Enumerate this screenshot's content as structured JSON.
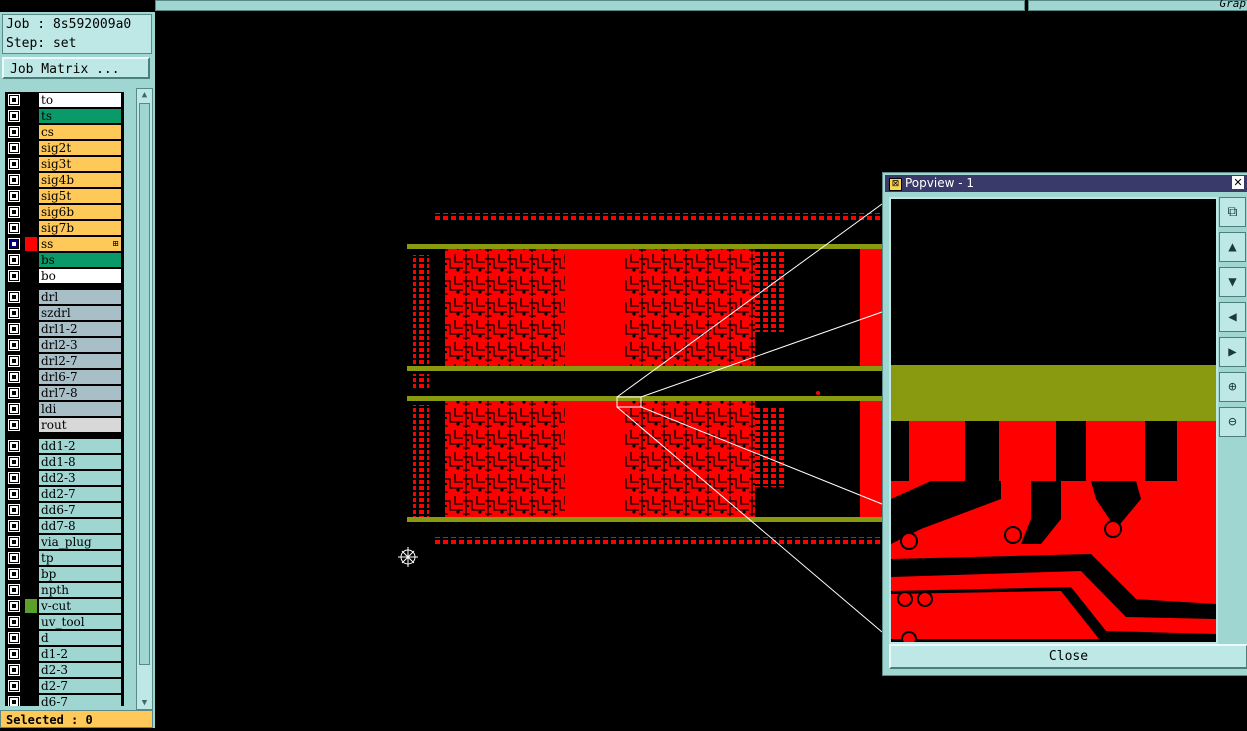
{
  "header": {
    "graph_label": "Grap"
  },
  "job": {
    "job_label": "Job : 8s592009a0",
    "step_label": "Step: set"
  },
  "job_matrix_button": "Job Matrix ...",
  "layer_groups": [
    [
      {
        "name": "to",
        "color": "#ffffff",
        "sel": false
      },
      {
        "name": "ts",
        "color": "#0a9a6a",
        "sel": false
      },
      {
        "name": "cs",
        "color": "#ffc95a",
        "sel": false
      },
      {
        "name": "sig2t",
        "color": "#ffc95a",
        "sel": false
      },
      {
        "name": "sig3t",
        "color": "#ffc95a",
        "sel": false
      },
      {
        "name": "sig4b",
        "color": "#ffc95a",
        "sel": false
      },
      {
        "name": "sig5t",
        "color": "#ffc95a",
        "sel": false
      },
      {
        "name": "sig6b",
        "color": "#ffc95a",
        "sel": false
      },
      {
        "name": "sig7b",
        "color": "#ffc95a",
        "sel": false
      },
      {
        "name": "ss",
        "color": "#ffc95a",
        "sel": true,
        "swatch": "#ff0000",
        "indicator": "⊞"
      },
      {
        "name": "bs",
        "color": "#0a9a6a",
        "sel": false
      },
      {
        "name": "bo",
        "color": "#ffffff",
        "sel": false
      }
    ],
    [
      {
        "name": "drl",
        "color": "#a9bfc8",
        "sel": false
      },
      {
        "name": "szdrl",
        "color": "#a9bfc8",
        "sel": false
      },
      {
        "name": "drl1-2",
        "color": "#a9bfc8",
        "sel": false
      },
      {
        "name": "drl2-3",
        "color": "#a9bfc8",
        "sel": false
      },
      {
        "name": "drl2-7",
        "color": "#a9bfc8",
        "sel": false
      },
      {
        "name": "drl6-7",
        "color": "#a9bfc8",
        "sel": false
      },
      {
        "name": "drl7-8",
        "color": "#a9bfc8",
        "sel": false
      },
      {
        "name": "ldi",
        "color": "#a9bfc8",
        "sel": false
      },
      {
        "name": "rout",
        "color": "#d8d8d8",
        "sel": false
      }
    ],
    [
      {
        "name": "dd1-2",
        "color": "#9fd6d2",
        "sel": false
      },
      {
        "name": "dd1-8",
        "color": "#9fd6d2",
        "sel": false
      },
      {
        "name": "dd2-3",
        "color": "#9fd6d2",
        "sel": false
      },
      {
        "name": "dd2-7",
        "color": "#9fd6d2",
        "sel": false
      },
      {
        "name": "dd6-7",
        "color": "#9fd6d2",
        "sel": false
      },
      {
        "name": "dd7-8",
        "color": "#9fd6d2",
        "sel": false
      },
      {
        "name": "via_plug",
        "color": "#9fd6d2",
        "sel": false
      },
      {
        "name": "tp",
        "color": "#9fd6d2",
        "sel": false
      },
      {
        "name": "bp",
        "color": "#9fd6d2",
        "sel": false
      },
      {
        "name": "npth",
        "color": "#9fd6d2",
        "sel": false
      },
      {
        "name": "v-cut",
        "color": "#9fd6d2",
        "sel": false,
        "swatch": "#5aa02a"
      },
      {
        "name": "uv_tool",
        "color": "#9fd6d2",
        "sel": false
      },
      {
        "name": "d",
        "color": "#9fd6d2",
        "sel": false
      },
      {
        "name": "d1-2",
        "color": "#9fd6d2",
        "sel": false
      },
      {
        "name": "d2-3",
        "color": "#9fd6d2",
        "sel": false
      },
      {
        "name": "d2-7",
        "color": "#9fd6d2",
        "sel": false
      },
      {
        "name": "d6-7",
        "color": "#9fd6d2",
        "sel": false
      }
    ]
  ],
  "status": {
    "selected": "Selected : 0"
  },
  "popview": {
    "title": "Popview - 1",
    "close_label": "Close",
    "tools": [
      "zoom-fit-icon",
      "pan-up-icon",
      "pan-down-icon",
      "pan-left-icon",
      "pan-right-icon",
      "zoom-in-icon",
      "zoom-out-icon"
    ]
  },
  "colors": {
    "copper": "#ff0000",
    "board_edge": "#8a9a10",
    "panel_bg": "#9fd6d2",
    "active_bar": "#ffc95a"
  }
}
